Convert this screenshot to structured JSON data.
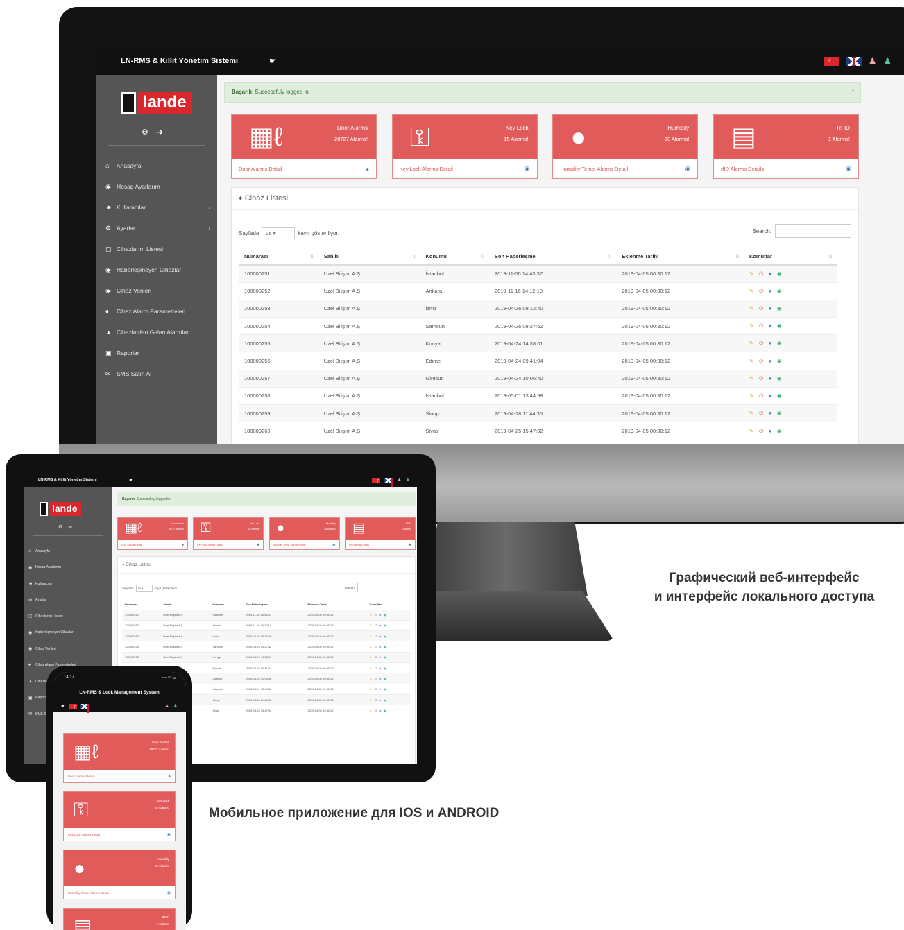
{
  "app": {
    "title": "LN-RMS & Killit Yönetim Sistemi",
    "mobile_title": "LN-RMS & Lock Management System",
    "logo_text": "lande"
  },
  "alert": {
    "prefix": "Başarılı",
    "message": "Successfuly logged in."
  },
  "sidebar": {
    "items": [
      {
        "icon": "home-icon",
        "label": "Anasayfa"
      },
      {
        "icon": "user-circle-icon",
        "label": "Hesap Ayarlarım"
      },
      {
        "icon": "users-icon",
        "label": "Kullanıcılar"
      },
      {
        "icon": "gear-icon",
        "label": "Ayarlar"
      },
      {
        "icon": "monitor-icon",
        "label": "Cihazlarım Listesi"
      },
      {
        "icon": "warning-circle-icon",
        "label": "Haberleşmeyen Cihazlar"
      },
      {
        "icon": "data-icon",
        "label": "Cihaz Verileri"
      },
      {
        "icon": "bell-icon",
        "label": "Cihaz Alarm Parametreleri"
      },
      {
        "icon": "triangle-icon",
        "label": "Cihazlardan Gelen Alarmlar"
      },
      {
        "icon": "briefcase-icon",
        "label": "Raporlar"
      },
      {
        "icon": "envelope-icon",
        "label": "SMS Satın Al"
      }
    ]
  },
  "cards": [
    {
      "icon": "door-icon",
      "title": "Door Alarms",
      "count": "28727 Alarms!",
      "link": "Door Alarms Detail",
      "link_icon": "bell-icon"
    },
    {
      "icon": "key-icon",
      "title": "Key Lock",
      "count": "15 Alarms!",
      "link": "Key Lock Alarms Detail",
      "link_icon": "info-circle-icon"
    },
    {
      "icon": "drop-icon",
      "title": "Humidity",
      "count": "20 Alarms!",
      "link": "Humidity Temp. Alarms Detail",
      "link_icon": "info-circle-icon"
    },
    {
      "icon": "id-card-icon",
      "title": "RFID",
      "count": "1 Alarms!",
      "link": "rfID Alarms Details",
      "link_icon": "info-circle-icon"
    }
  ],
  "panel": {
    "title": "Cihaz Listesi",
    "page_size_prefix": "Sayfada",
    "page_size": "25",
    "page_size_suffix": "kayıt gösteriliyor.",
    "search_label": "Search:"
  },
  "table": {
    "columns": [
      "Numarası",
      "Sahibi",
      "Konumu",
      "Son Haberleşme",
      "Eklenme Tarihi",
      "Komutlar"
    ],
    "rows": [
      [
        "100000251",
        "Uzel Bilişim A.Ş",
        "İstanbul",
        "2019-11-06 14:43:37",
        "2019-04-05 00:30:12"
      ],
      [
        "100000252",
        "Uzel Bilişim A.Ş",
        "Ankara",
        "2019-11-16 14:12:10",
        "2019-04-05 00:30:12"
      ],
      [
        "100000253",
        "Uzel Bilişim A.Ş",
        "izmir",
        "2019-04-26 09:12:40",
        "2019-04-05 00:30:12"
      ],
      [
        "100000254",
        "Uzel Bilişim A.Ş",
        "Samsun",
        "2019-04-26 09:27:52",
        "2019-04-05 00:30:12"
      ],
      [
        "100000255",
        "Uzel Bilişim A.Ş",
        "Konya",
        "2019-04-24 14:38:01",
        "2019-04-05 00:30:12"
      ],
      [
        "100000256",
        "Uzel Bilişim A.Ş",
        "Edirne",
        "2019-04-24 09:41:04",
        "2019-04-05 00:30:12"
      ],
      [
        "100000257",
        "Uzel Bilişim A.Ş",
        "Giresun",
        "2019-04-24 10:06:40",
        "2019-04-05 00:30:12"
      ],
      [
        "100000258",
        "Uzel Bilişim A.Ş",
        "İstanbul",
        "2019-05-01 13:44:58",
        "2019-04-05 00:30:12"
      ],
      [
        "100000259",
        "Uzel Bilişim A.Ş",
        "Sinop",
        "2019-04-18 11:44:35",
        "2019-04-05 00:30:12"
      ],
      [
        "100000260",
        "Uzel Bilişim A.Ş",
        "Sivas",
        "2019-04-25 15:47:02",
        "2019-04-05 00:30:12"
      ]
    ]
  },
  "phone": {
    "time": "14:17",
    "status": "▪▪▪ ◠ ▭"
  },
  "captions": {
    "web_line1": "Графический веб-интерфейс",
    "web_line2": "и интерфейс локального доступа",
    "mobile": "Мобильное приложение для IOS и ANDROID"
  },
  "colors": {
    "accent": "#e15b5b",
    "sidebar": "#555555",
    "topbar": "#111111",
    "alert_bg": "#dfeedd"
  }
}
